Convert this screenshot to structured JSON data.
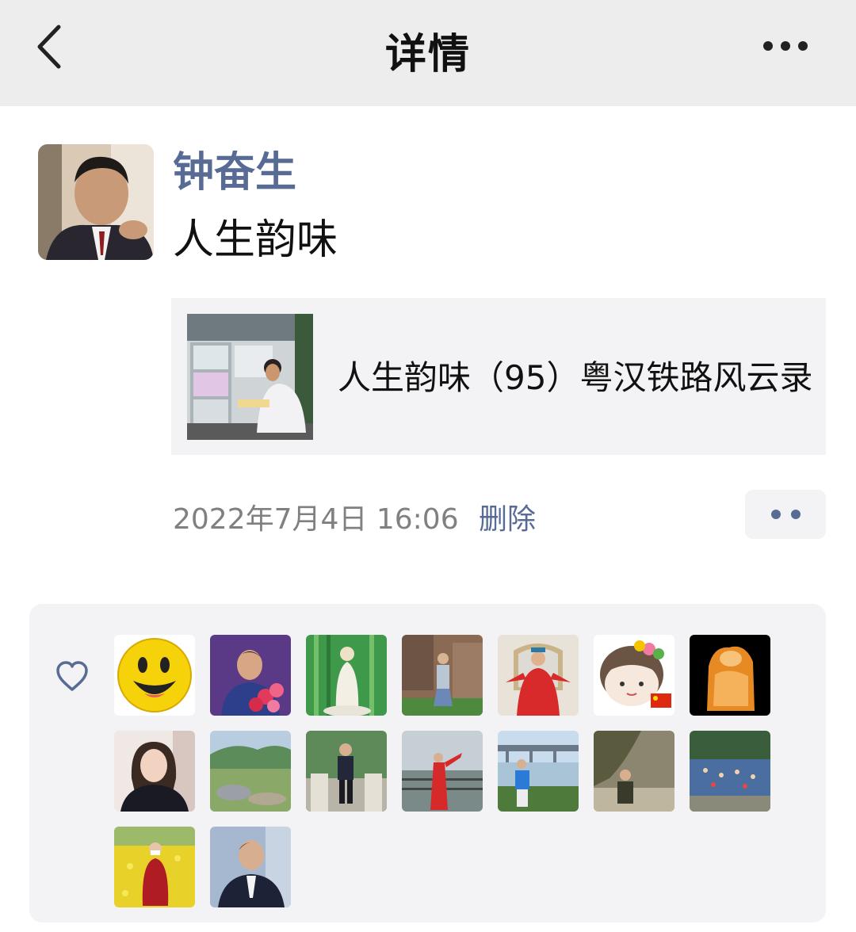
{
  "header": {
    "title": "详情",
    "back_icon": "chevron-left-icon",
    "more_icon": "ellipsis-icon"
  },
  "post": {
    "author": "钟奋生",
    "text": "人生韵味",
    "link_card": {
      "title": "人生韵味（95）粤汉铁路风云录"
    },
    "timestamp": "2022年7月4日 16:06",
    "delete_label": "删除",
    "action_icon": "two-dots-icon"
  },
  "likes": {
    "icon": "heart-outline-icon",
    "count": 16
  },
  "colors": {
    "link_blue": "#576b95",
    "header_bg": "#ededed",
    "card_bg": "#f3f3f5"
  }
}
